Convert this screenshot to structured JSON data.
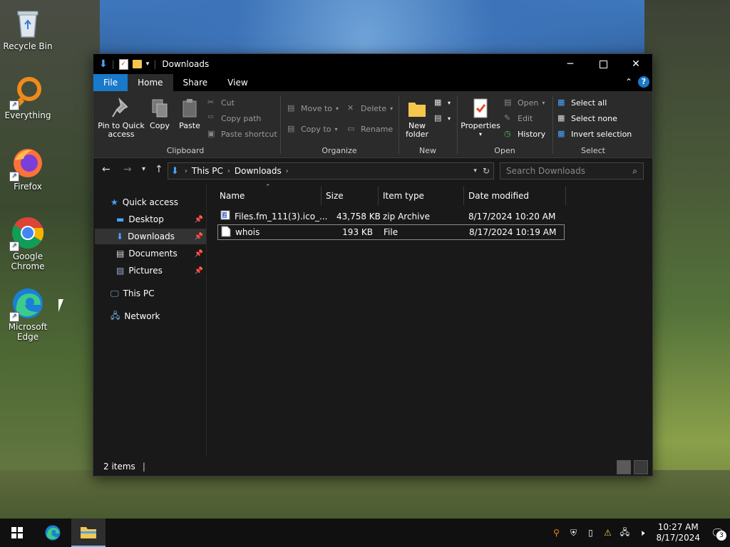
{
  "desktop": {
    "icons": [
      {
        "label": "Recycle Bin",
        "icon": "recycle-bin-icon"
      },
      {
        "label": "Everything",
        "icon": "everything-search-icon"
      },
      {
        "label": "Firefox",
        "icon": "firefox-icon"
      },
      {
        "label": "Google Chrome",
        "icon": "chrome-icon"
      },
      {
        "label": "Microsoft Edge",
        "icon": "edge-icon"
      }
    ]
  },
  "window": {
    "title": "Downloads",
    "tabs": {
      "file": "File",
      "home": "Home",
      "share": "Share",
      "view": "View"
    },
    "help": "?",
    "ribbon": {
      "clipboard": {
        "label": "Clipboard",
        "pin": "Pin to Quick access",
        "copy": "Copy",
        "paste": "Paste",
        "cut": "Cut",
        "copy_path": "Copy path",
        "paste_shortcut": "Paste shortcut"
      },
      "organize": {
        "label": "Organize",
        "move_to": "Move to",
        "copy_to": "Copy to",
        "delete": "Delete",
        "rename": "Rename"
      },
      "new": {
        "label": "New",
        "new_folder": "New folder"
      },
      "open": {
        "label": "Open",
        "properties": "Properties",
        "open": "Open",
        "edit": "Edit",
        "history": "History"
      },
      "select": {
        "label": "Select",
        "select_all": "Select all",
        "select_none": "Select none",
        "invert": "Invert selection"
      }
    },
    "address": {
      "crumbs": [
        "This PC",
        "Downloads"
      ],
      "search_placeholder": "Search Downloads"
    },
    "nav": {
      "quick_access": "Quick access",
      "desktop": "Desktop",
      "downloads": "Downloads",
      "documents": "Documents",
      "pictures": "Pictures",
      "this_pc": "This PC",
      "network": "Network"
    },
    "columns": {
      "name": "Name",
      "size": "Size",
      "type": "Item type",
      "modified": "Date modified"
    },
    "files": [
      {
        "name": "Files.fm_111(3).ico_...",
        "size": "43,758 KB",
        "type": "zip Archive",
        "modified": "8/17/2024 10:20 AM"
      },
      {
        "name": "whois",
        "size": "193 KB",
        "type": "File",
        "modified": "8/17/2024 10:19 AM"
      }
    ],
    "status": "2 items"
  },
  "taskbar": {
    "time": "10:27 AM",
    "date": "8/17/2024",
    "notifications": "3"
  }
}
